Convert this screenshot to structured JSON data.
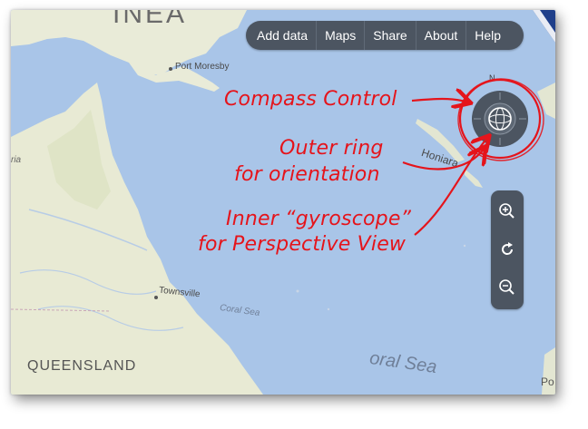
{
  "toolbar": {
    "items": [
      {
        "label": "Add data"
      },
      {
        "label": "Maps"
      },
      {
        "label": "Share"
      },
      {
        "label": "About"
      },
      {
        "label": "Help"
      }
    ]
  },
  "map": {
    "labels": {
      "top_region": "INEA",
      "port_moresby": "Port Moresby",
      "honiara": "Honiara",
      "townsville": "Townsville",
      "coral_sea_small": "Coral Sea",
      "coral_sea_large": "oral Sea",
      "queensland": "QUEENSLAND",
      "left_edge": "ria",
      "right_edge": "Po",
      "north_marker": "N"
    }
  },
  "annotations": {
    "compass": "Compass Control",
    "outer_ring_1": "Outer ring",
    "outer_ring_2": "for orientation",
    "gyro_1": "Inner “gyroscope”",
    "gyro_2": "for Perspective View"
  },
  "colors": {
    "sea": "#a9c5e8",
    "land": "#e8ead6",
    "toolbar": "#4c5561",
    "annotation": "#e5141b"
  }
}
